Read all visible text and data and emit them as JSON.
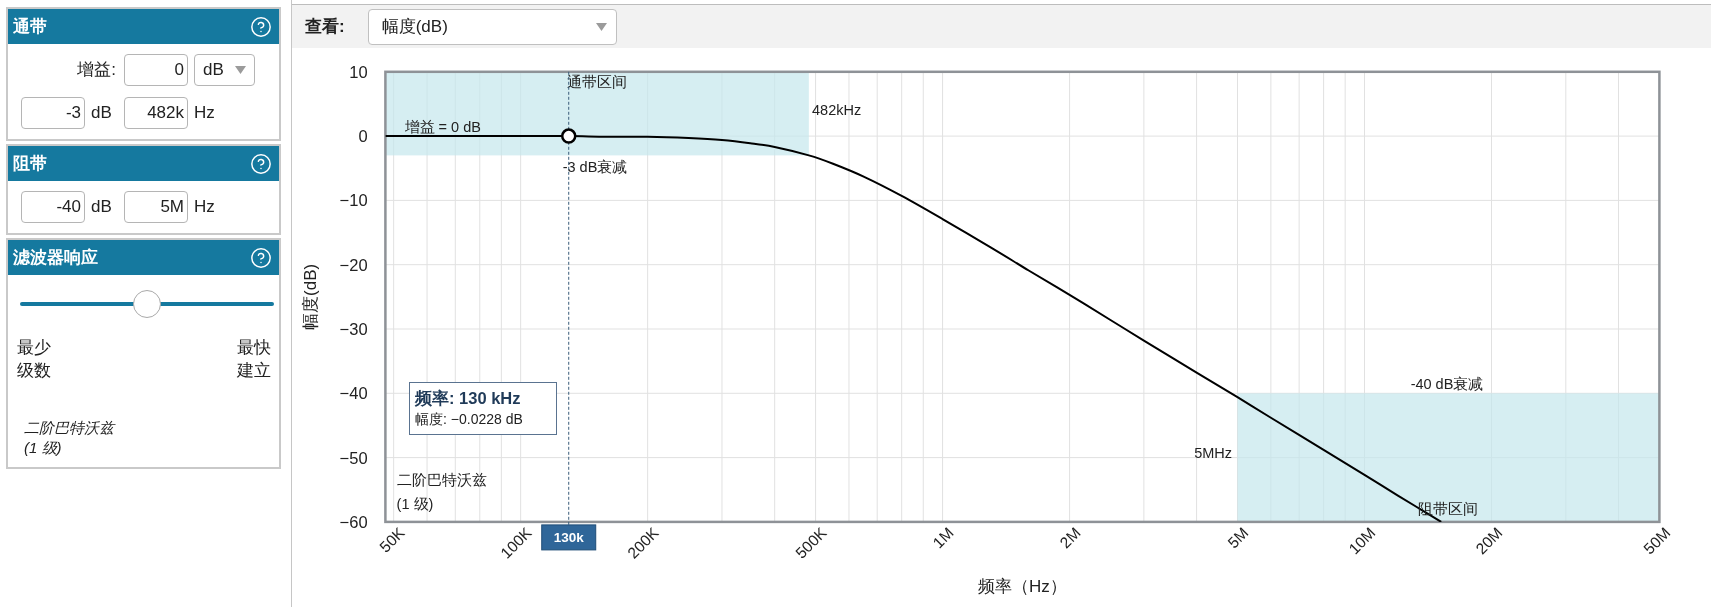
{
  "passband": {
    "title": "通带",
    "gain_label": "增益:",
    "gain_value": "0",
    "gain_unit": "dB",
    "attenuation_value": "-3",
    "attenuation_unit": "dB",
    "frequency_value": "482k",
    "frequency_unit": "Hz"
  },
  "stopband": {
    "title": "阻带",
    "attenuation_value": "-40",
    "attenuation_unit": "dB",
    "frequency_value": "5M",
    "frequency_unit": "Hz"
  },
  "filter_response": {
    "title": "滤波器响应",
    "slider": {
      "level": 0.5
    },
    "min_label": "最少级数",
    "max_label": "最快建立",
    "filter_type": "二阶巴特沃兹",
    "stages": "(1 级)"
  },
  "view": {
    "label": "查看:",
    "select": "幅度(dB)"
  },
  "chart": {
    "tooltip": {
      "title": "频率: 130 kHz",
      "value": "幅度: −0.0228 dB"
    },
    "chart_data": {
      "type": "line",
      "xlabel": "频率（Hz）",
      "ylabel": "幅度(dB)",
      "log": "x",
      "grid": true,
      "x": [
        47800,
        50000,
        60000,
        70000,
        80000,
        100000,
        130000,
        160000,
        200000,
        250000,
        300000,
        350000,
        400000,
        482000,
        550000,
        650000,
        800000,
        1000000,
        1300000,
        1600000,
        2000000,
        2500000,
        3000000,
        4000000,
        5000000,
        6000000,
        8000000,
        10000000,
        12000000,
        15200000
      ],
      "series": [
        {
          "color": "#000000",
          "values": [
            0,
            0,
            0,
            0,
            0,
            0,
            0,
            -0.1,
            -0.1,
            -0.3,
            -0.6,
            -1.1,
            -1.7,
            -3,
            -4.3,
            -6.3,
            -9.3,
            -12.9,
            -17.3,
            -20.9,
            -24.7,
            -28.6,
            -31.8,
            -36.8,
            -40.6,
            -43.8,
            -48.8,
            -52.7,
            -55.9,
            -60
          ]
        }
      ],
      "xlim": [
        47800,
        50000000
      ],
      "ylim": [
        -60,
        10
      ],
      "xticks": [
        {
          "value": 50000,
          "label": "50K"
        },
        {
          "value": 100000,
          "label": "100K"
        },
        {
          "value": 200000,
          "label": "200K"
        },
        {
          "value": 500000,
          "label": "500K"
        },
        {
          "value": 1000000,
          "label": "1M"
        },
        {
          "value": 2000000,
          "label": "2M"
        },
        {
          "value": 5000000,
          "label": "5M"
        },
        {
          "value": 10000000,
          "label": "10M"
        },
        {
          "value": 20000000,
          "label": "20M"
        },
        {
          "value": 50000000,
          "label": "50M"
        }
      ],
      "yticks": [
        {
          "value": 10,
          "label": "10"
        },
        {
          "value": 0,
          "label": "0"
        },
        {
          "value": -10,
          "label": "−10"
        },
        {
          "value": -20,
          "label": "−20"
        },
        {
          "value": -30,
          "label": "−30"
        },
        {
          "value": -40,
          "label": "−40"
        },
        {
          "value": -50,
          "label": "−50"
        },
        {
          "value": -60,
          "label": "−60"
        }
      ],
      "bands": [
        {
          "axis": "x",
          "from": 47800,
          "to": 482000,
          "label": "通带区间"
        },
        {
          "axis": "x",
          "from": 5000000,
          "to": 50000000,
          "label": "阻带区间"
        }
      ],
      "ref_lines": [
        {
          "axis": "x",
          "value": 130000,
          "label": "130k"
        }
      ],
      "annotations": [
        "482kHz",
        "增益 = 0 dB",
        "-3 dB衰减",
        "-40 dB衰减",
        "5MHz",
        "二阶巴特沃兹",
        "(1 级)"
      ]
    }
  }
}
